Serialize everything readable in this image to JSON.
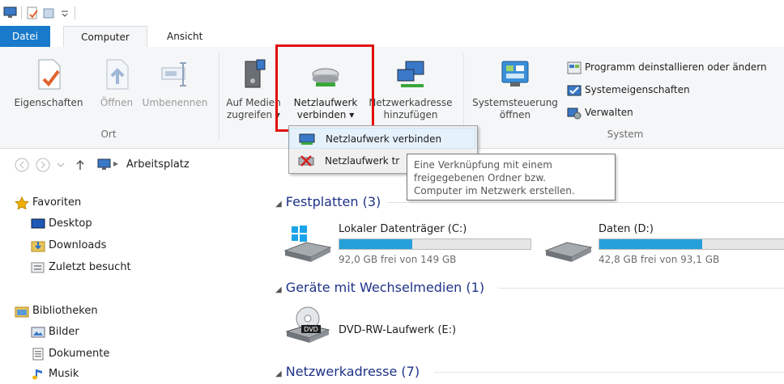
{
  "tabs": {
    "file": "Datei",
    "computer": "Computer",
    "view": "Ansicht"
  },
  "ribbon": {
    "ort": {
      "label": "Ort",
      "properties": "Eigenschaften",
      "open": "Öffnen",
      "rename": "Umbenennen"
    },
    "netzwerk": {
      "media_line1": "Auf Medien",
      "media_line2": "zugreifen",
      "map_line1": "Netzlaufwerk",
      "map_line2": "verbinden",
      "addr_line1": "Netzwerkadresse",
      "addr_line2": "hinzufügen"
    },
    "system": {
      "label": "System",
      "control_line1": "Systemsteuerung",
      "control_line2": "öffnen",
      "uninstall": "Programm deinstallieren oder ändern",
      "sysprops": "Systemeigenschaften",
      "manage": "Verwalten"
    }
  },
  "dropdown": {
    "item1": "Netzlaufwerk verbinden",
    "item2": "Netzlaufwerk tr"
  },
  "tooltip": {
    "line1": "Eine Verknüpfung mit einem",
    "line2": "freigegebenen Ordner bzw.",
    "line3": "Computer im Netzwerk erstellen."
  },
  "address": {
    "location": "Arbeitsplatz"
  },
  "nav": {
    "favorites": "Favoriten",
    "desktop": "Desktop",
    "downloads": "Downloads",
    "recent": "Zuletzt besucht",
    "libraries": "Bibliotheken",
    "pictures": "Bilder",
    "documents": "Dokumente",
    "music": "Musik"
  },
  "content": {
    "hdd_header": "Festplatten (3)",
    "drive_c": {
      "name": "Lokaler Datenträger (C:)",
      "free": "92,0 GB frei von 149 GB",
      "used_fraction": 0.38
    },
    "drive_d": {
      "name": "Daten (D:)",
      "free": "42,8 GB frei von 93,1 GB",
      "used_fraction": 0.54
    },
    "removable_header": "Geräte mit Wechselmedien (1)",
    "dvd": {
      "name": "DVD-RW-Laufwerk (E:)",
      "badge": "DVD"
    },
    "network_header": "Netzwerkadresse (7)"
  },
  "colors": {
    "accent": "#1979ca",
    "highlight": "#e20d0d",
    "bar_fill": "#26a0da",
    "section_text": "#1e3287"
  }
}
